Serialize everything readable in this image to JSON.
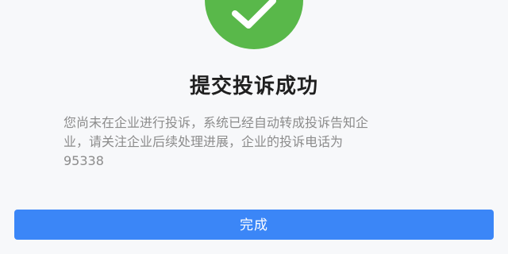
{
  "screen": {
    "icon": "checkmark-icon",
    "title": "提交投诉成功",
    "message_lines": [
      "您尚未在企业进行投诉，系统已经自动转成投诉告知企",
      "业，请关注企业后续处理进展，企业的投诉电话为",
      "95338"
    ],
    "button_label": "完成",
    "accent_color": "#3b86f7",
    "success_color": "#59b84a"
  }
}
